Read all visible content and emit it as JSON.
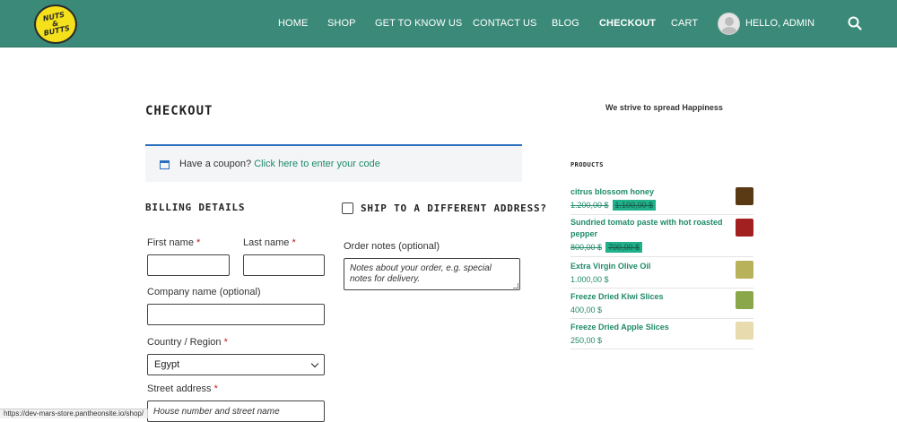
{
  "logo": {
    "text_line1": "NUTS",
    "text_line2": "&",
    "text_line3": "BUTTS"
  },
  "nav": {
    "items": [
      "HOME",
      "SHOP",
      "GET TO KNOW US",
      "CONTACT US",
      "BLOG",
      "CHECKOUT",
      "CART"
    ],
    "active": "CHECKOUT",
    "user_greeting": "HELLO, ADMIN",
    "search_icon": "search-icon"
  },
  "page": {
    "title": "CHECKOUT",
    "tagline": "We strive to spread Happiness"
  },
  "coupon": {
    "text": "Have a coupon?",
    "link": "Click here to enter your code",
    "icon": "calendar-icon"
  },
  "billing": {
    "heading": "BILLING DETAILS",
    "first_name_label": "First name",
    "last_name_label": "Last name",
    "company_label": "Company name (optional)",
    "country_label": "Country / Region",
    "country_value": "Egypt",
    "street_label": "Street address",
    "street_placeholder": "House number and street name",
    "required_mark": "*"
  },
  "shipping": {
    "heading": "SHIP TO A DIFFERENT ADDRESS?",
    "order_notes_label": "Order notes (optional)",
    "order_notes_placeholder": "Notes about your order, e.g. special notes for delivery."
  },
  "sidebar": {
    "products_heading": "PRODUCTS",
    "products": [
      {
        "name": "citrus blossom honey",
        "price_old": "1.200,00 $",
        "price_new": "1.100,00 $",
        "thumb_color": "#5a3a14"
      },
      {
        "name": "Sundried tomato paste with hot roasted pepper",
        "price_old": "800,00 $",
        "price_new": "700,00 $",
        "thumb_color": "#a32020"
      },
      {
        "name": "Extra Virgin Olive Oil",
        "price": "1.000,00 $",
        "thumb_color": "#b8b25a"
      },
      {
        "name": "Freeze Dried Kiwi Slices",
        "price": "400,00 $",
        "thumb_color": "#8aa84a"
      },
      {
        "name": "Freeze Dried Apple Slices",
        "price": "250,00 $",
        "thumb_color": "#e8dcae"
      }
    ]
  },
  "status_url": "https://dev-mars-store.pantheonsite.io/shop/",
  "colors": {
    "header": "#3b8a79",
    "accent_link": "#1f8a6a",
    "coupon_border": "#2a6fbf",
    "logo_yellow": "#f5e11b"
  }
}
